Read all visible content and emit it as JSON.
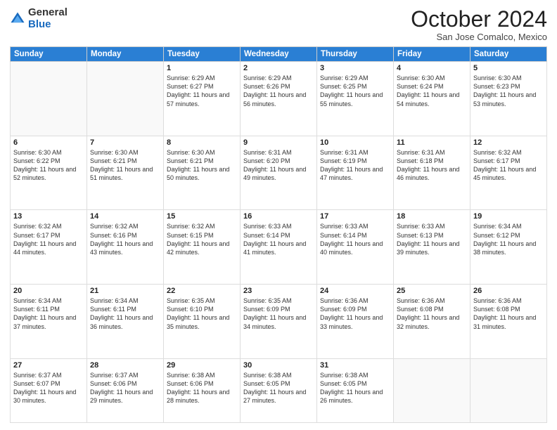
{
  "logo": {
    "general": "General",
    "blue": "Blue"
  },
  "title": "October 2024",
  "subtitle": "San Jose Comalco, Mexico",
  "headers": [
    "Sunday",
    "Monday",
    "Tuesday",
    "Wednesday",
    "Thursday",
    "Friday",
    "Saturday"
  ],
  "weeks": [
    [
      {
        "day": "",
        "info": ""
      },
      {
        "day": "",
        "info": ""
      },
      {
        "day": "1",
        "info": "Sunrise: 6:29 AM\nSunset: 6:27 PM\nDaylight: 11 hours and 57 minutes."
      },
      {
        "day": "2",
        "info": "Sunrise: 6:29 AM\nSunset: 6:26 PM\nDaylight: 11 hours and 56 minutes."
      },
      {
        "day": "3",
        "info": "Sunrise: 6:29 AM\nSunset: 6:25 PM\nDaylight: 11 hours and 55 minutes."
      },
      {
        "day": "4",
        "info": "Sunrise: 6:30 AM\nSunset: 6:24 PM\nDaylight: 11 hours and 54 minutes."
      },
      {
        "day": "5",
        "info": "Sunrise: 6:30 AM\nSunset: 6:23 PM\nDaylight: 11 hours and 53 minutes."
      }
    ],
    [
      {
        "day": "6",
        "info": "Sunrise: 6:30 AM\nSunset: 6:22 PM\nDaylight: 11 hours and 52 minutes."
      },
      {
        "day": "7",
        "info": "Sunrise: 6:30 AM\nSunset: 6:21 PM\nDaylight: 11 hours and 51 minutes."
      },
      {
        "day": "8",
        "info": "Sunrise: 6:30 AM\nSunset: 6:21 PM\nDaylight: 11 hours and 50 minutes."
      },
      {
        "day": "9",
        "info": "Sunrise: 6:31 AM\nSunset: 6:20 PM\nDaylight: 11 hours and 49 minutes."
      },
      {
        "day": "10",
        "info": "Sunrise: 6:31 AM\nSunset: 6:19 PM\nDaylight: 11 hours and 47 minutes."
      },
      {
        "day": "11",
        "info": "Sunrise: 6:31 AM\nSunset: 6:18 PM\nDaylight: 11 hours and 46 minutes."
      },
      {
        "day": "12",
        "info": "Sunrise: 6:32 AM\nSunset: 6:17 PM\nDaylight: 11 hours and 45 minutes."
      }
    ],
    [
      {
        "day": "13",
        "info": "Sunrise: 6:32 AM\nSunset: 6:17 PM\nDaylight: 11 hours and 44 minutes."
      },
      {
        "day": "14",
        "info": "Sunrise: 6:32 AM\nSunset: 6:16 PM\nDaylight: 11 hours and 43 minutes."
      },
      {
        "day": "15",
        "info": "Sunrise: 6:32 AM\nSunset: 6:15 PM\nDaylight: 11 hours and 42 minutes."
      },
      {
        "day": "16",
        "info": "Sunrise: 6:33 AM\nSunset: 6:14 PM\nDaylight: 11 hours and 41 minutes."
      },
      {
        "day": "17",
        "info": "Sunrise: 6:33 AM\nSunset: 6:14 PM\nDaylight: 11 hours and 40 minutes."
      },
      {
        "day": "18",
        "info": "Sunrise: 6:33 AM\nSunset: 6:13 PM\nDaylight: 11 hours and 39 minutes."
      },
      {
        "day": "19",
        "info": "Sunrise: 6:34 AM\nSunset: 6:12 PM\nDaylight: 11 hours and 38 minutes."
      }
    ],
    [
      {
        "day": "20",
        "info": "Sunrise: 6:34 AM\nSunset: 6:11 PM\nDaylight: 11 hours and 37 minutes."
      },
      {
        "day": "21",
        "info": "Sunrise: 6:34 AM\nSunset: 6:11 PM\nDaylight: 11 hours and 36 minutes."
      },
      {
        "day": "22",
        "info": "Sunrise: 6:35 AM\nSunset: 6:10 PM\nDaylight: 11 hours and 35 minutes."
      },
      {
        "day": "23",
        "info": "Sunrise: 6:35 AM\nSunset: 6:09 PM\nDaylight: 11 hours and 34 minutes."
      },
      {
        "day": "24",
        "info": "Sunrise: 6:36 AM\nSunset: 6:09 PM\nDaylight: 11 hours and 33 minutes."
      },
      {
        "day": "25",
        "info": "Sunrise: 6:36 AM\nSunset: 6:08 PM\nDaylight: 11 hours and 32 minutes."
      },
      {
        "day": "26",
        "info": "Sunrise: 6:36 AM\nSunset: 6:08 PM\nDaylight: 11 hours and 31 minutes."
      }
    ],
    [
      {
        "day": "27",
        "info": "Sunrise: 6:37 AM\nSunset: 6:07 PM\nDaylight: 11 hours and 30 minutes."
      },
      {
        "day": "28",
        "info": "Sunrise: 6:37 AM\nSunset: 6:06 PM\nDaylight: 11 hours and 29 minutes."
      },
      {
        "day": "29",
        "info": "Sunrise: 6:38 AM\nSunset: 6:06 PM\nDaylight: 11 hours and 28 minutes."
      },
      {
        "day": "30",
        "info": "Sunrise: 6:38 AM\nSunset: 6:05 PM\nDaylight: 11 hours and 27 minutes."
      },
      {
        "day": "31",
        "info": "Sunrise: 6:38 AM\nSunset: 6:05 PM\nDaylight: 11 hours and 26 minutes."
      },
      {
        "day": "",
        "info": ""
      },
      {
        "day": "",
        "info": ""
      }
    ]
  ]
}
